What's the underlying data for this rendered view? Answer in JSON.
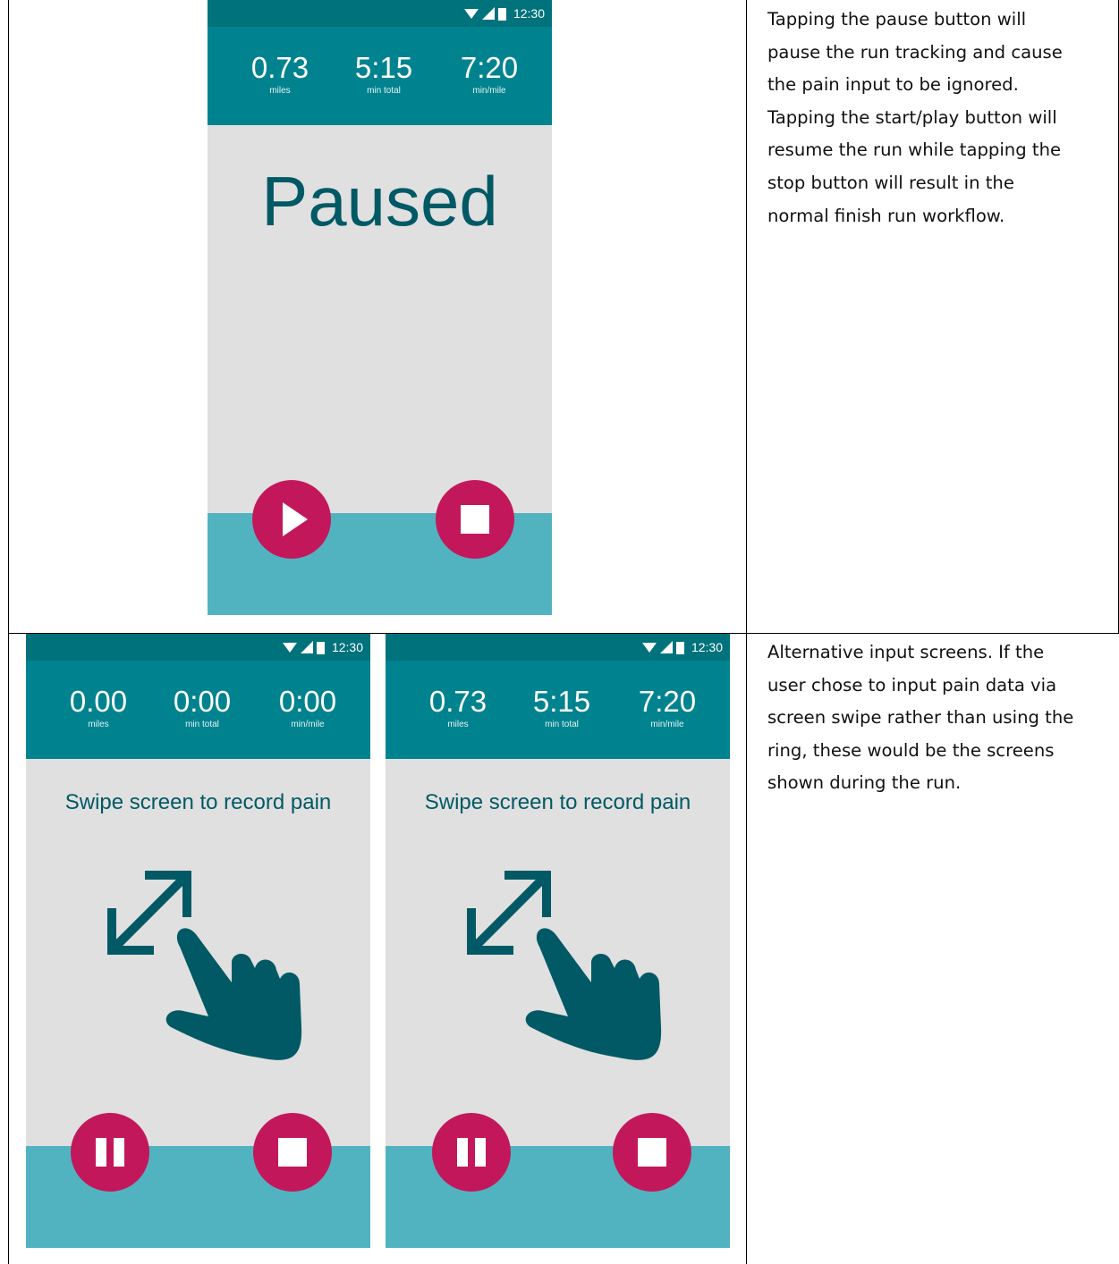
{
  "status_bar": {
    "time": "12:30"
  },
  "screen_paused": {
    "stats": [
      {
        "value": "0.73",
        "label": "miles"
      },
      {
        "value": "5:15",
        "label": "min total"
      },
      {
        "value": "7:20",
        "label": "min/mile"
      }
    ],
    "message": "Paused"
  },
  "screen_swipe_a": {
    "stats": [
      {
        "value": "0.00",
        "label": "miles"
      },
      {
        "value": "0:00",
        "label": "min total"
      },
      {
        "value": "0:00",
        "label": "min/mile"
      }
    ],
    "instruction": "Swipe screen to record pain"
  },
  "screen_swipe_b": {
    "stats": [
      {
        "value": "0.73",
        "label": "miles"
      },
      {
        "value": "5:15",
        "label": "min total"
      },
      {
        "value": "7:20",
        "label": "min/mile"
      }
    ],
    "instruction": "Swipe screen to record pain"
  },
  "descriptions": {
    "row1": [
      "Tapping the pause button will",
      "pause the run tracking and cause",
      "the pain input to be ignored.",
      "Tapping the start/play button will",
      "resume the run while tapping the",
      "stop button will result in the",
      "normal finish run workflow."
    ],
    "row2": [
      "Alternative input screens. If the",
      "user chose to input pain data via",
      "screen swipe rather than using the",
      "ring, these would be the screens",
      "shown during the run."
    ]
  },
  "colors": {
    "status_bar": "#00727c",
    "app_bar": "#00838f",
    "content_bg": "#e0e0e0",
    "bottom_bar": "#52b3c0",
    "fab": "#c2185b",
    "accent_text": "#005964"
  },
  "icons": [
    "wifi-icon",
    "signal-icon",
    "battery-icon",
    "play-icon",
    "stop-icon",
    "pause-icon",
    "swipe-gesture-icon"
  ]
}
